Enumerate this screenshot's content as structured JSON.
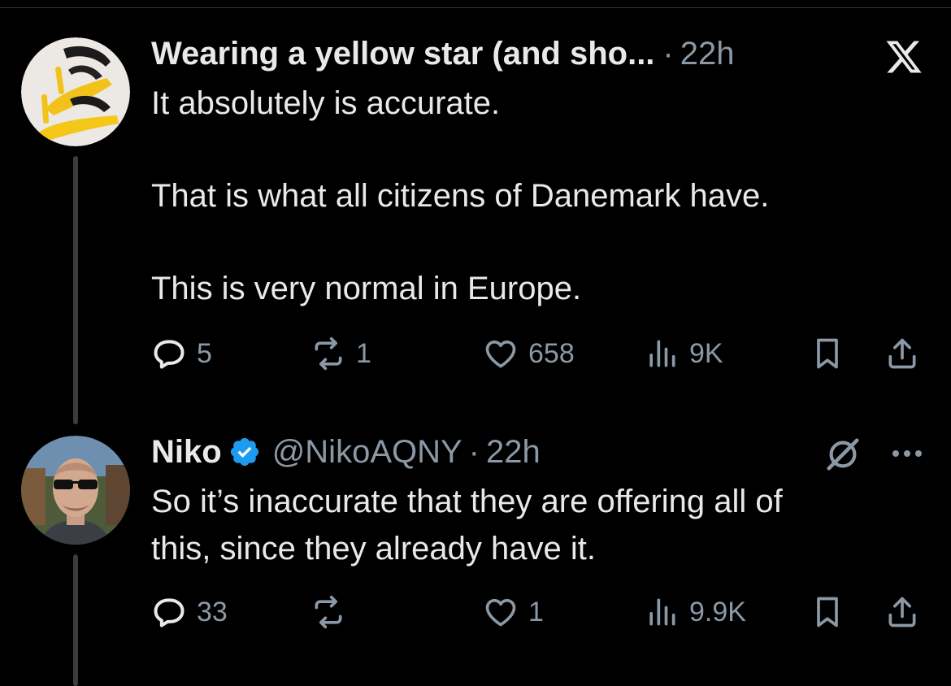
{
  "tweets": [
    {
      "author": "Wearing a yellow star (and sho...",
      "separator": "·",
      "time": "22h",
      "lines": [
        "It absolutely is accurate.",
        "That is what all citizens of Danemark have.",
        "This is very normal in Europe."
      ],
      "actions": {
        "replies": "5",
        "reposts": "1",
        "likes": "658",
        "views": "9K"
      },
      "avatar_icon": "yellow-high-heels-image"
    },
    {
      "author": "Niko",
      "verified": true,
      "handle": "@NikoAQNY",
      "separator": "·",
      "time": "22h",
      "body": "So it’s inaccurate that they are offering all of\nthis, since they already have it.",
      "actions": {
        "replies": "33",
        "reposts": "",
        "likes": "1",
        "views": "9.9K"
      },
      "avatar_icon": "man-with-sunglasses-photo"
    }
  ],
  "icons": {
    "platform": "x-logo-icon",
    "grok": "grok-icon",
    "more": "more-icon"
  },
  "colors": {
    "background": "#000000",
    "text": "#e7e9ea",
    "muted": "#8b98a5",
    "verified": "#1d9bf0"
  }
}
